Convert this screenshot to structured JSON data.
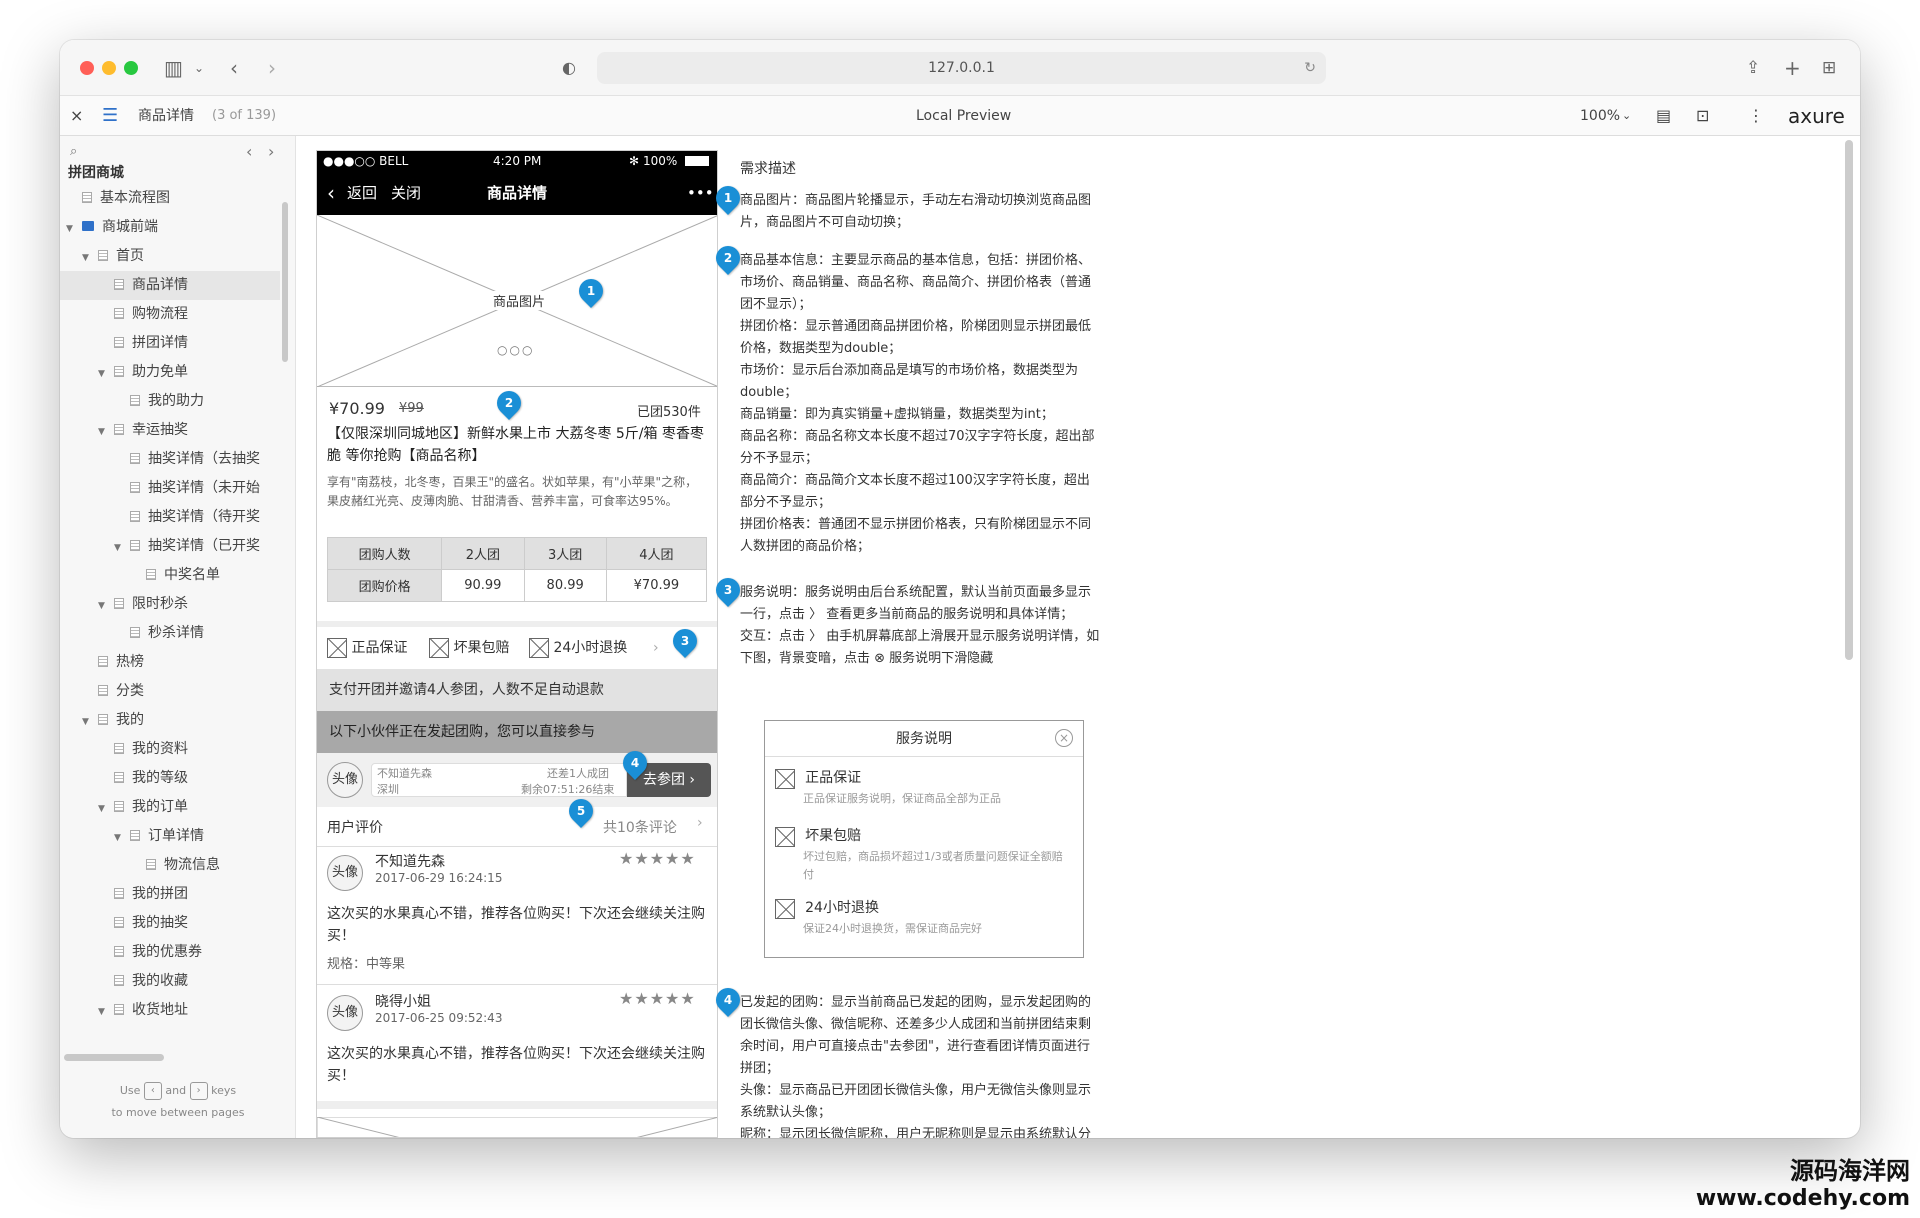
{
  "browser": {
    "url": "127.0.0.1",
    "traffic_colors": [
      "#ff5f57",
      "#febc2e",
      "#28c840"
    ]
  },
  "toolbar": {
    "close": "×",
    "page_title": "商品详情",
    "page_count": "(3 of 139)",
    "center": "Local Preview",
    "zoom": "100%",
    "brand": "axure"
  },
  "sidebar": {
    "project": "拼团商城",
    "items": [
      {
        "label": "基本流程图",
        "indent": 0,
        "arrow": "",
        "type": "page"
      },
      {
        "label": "商城前端",
        "indent": 0,
        "arrow": "▼",
        "type": "folder"
      },
      {
        "label": "首页",
        "indent": 1,
        "arrow": "▼",
        "type": "page"
      },
      {
        "label": "商品详情",
        "indent": 2,
        "arrow": "",
        "type": "page",
        "selected": true
      },
      {
        "label": "购物流程",
        "indent": 2,
        "arrow": "",
        "type": "page"
      },
      {
        "label": "拼团详情",
        "indent": 2,
        "arrow": "",
        "type": "page"
      },
      {
        "label": "助力免单",
        "indent": 2,
        "arrow": "▼",
        "type": "page"
      },
      {
        "label": "我的助力",
        "indent": 3,
        "arrow": "",
        "type": "page"
      },
      {
        "label": "幸运抽奖",
        "indent": 2,
        "arrow": "▼",
        "type": "page"
      },
      {
        "label": "抽奖详情（去抽奖",
        "indent": 3,
        "arrow": "",
        "type": "page"
      },
      {
        "label": "抽奖详情（未开始",
        "indent": 3,
        "arrow": "",
        "type": "page"
      },
      {
        "label": "抽奖详情（待开奖",
        "indent": 3,
        "arrow": "",
        "type": "page"
      },
      {
        "label": "抽奖详情（已开奖",
        "indent": 3,
        "arrow": "▼",
        "type": "page"
      },
      {
        "label": "中奖名单",
        "indent": 4,
        "arrow": "",
        "type": "page"
      },
      {
        "label": "限时秒杀",
        "indent": 2,
        "arrow": "▼",
        "type": "page"
      },
      {
        "label": "秒杀详情",
        "indent": 3,
        "arrow": "",
        "type": "page"
      },
      {
        "label": "热榜",
        "indent": 1,
        "arrow": "",
        "type": "page"
      },
      {
        "label": "分类",
        "indent": 1,
        "arrow": "",
        "type": "page"
      },
      {
        "label": "我的",
        "indent": 1,
        "arrow": "▼",
        "type": "page"
      },
      {
        "label": "我的资料",
        "indent": 2,
        "arrow": "",
        "type": "page"
      },
      {
        "label": "我的等级",
        "indent": 2,
        "arrow": "",
        "type": "page"
      },
      {
        "label": "我的订单",
        "indent": 2,
        "arrow": "▼",
        "type": "page"
      },
      {
        "label": "订单详情",
        "indent": 3,
        "arrow": "▼",
        "type": "page"
      },
      {
        "label": "物流信息",
        "indent": 4,
        "arrow": "",
        "type": "page"
      },
      {
        "label": "我的拼团",
        "indent": 2,
        "arrow": "",
        "type": "page"
      },
      {
        "label": "我的抽奖",
        "indent": 2,
        "arrow": "",
        "type": "page"
      },
      {
        "label": "我的优惠券",
        "indent": 2,
        "arrow": "",
        "type": "page"
      },
      {
        "label": "我的收藏",
        "indent": 2,
        "arrow": "",
        "type": "page"
      },
      {
        "label": "收货地址",
        "indent": 2,
        "arrow": "▼",
        "type": "page"
      }
    ],
    "hint_use": "Use",
    "hint_and": "and",
    "hint_keys": "keys",
    "hint_line2": "to move between pages"
  },
  "phone": {
    "carrier": "●●●○○ BELL",
    "time": "4:20 PM",
    "battery": "100%",
    "back": "返回",
    "close": "关闭",
    "nav_title": "商品详情",
    "more": "•••",
    "image_label": "商品图片",
    "dots": "○○○",
    "price": "¥70.99",
    "market_price": "¥99",
    "sold": "已团530件",
    "name": "【仅限深圳同城地区】新鲜水果上市 大荔冬枣 5斤/箱 枣香枣脆 等你抢购【商品名称】",
    "intro": "享有\"南荔枝，北冬枣，百果王\"的盛名。状如苹果，有\"小苹果\"之称，果皮赭红光亮、皮薄肉脆、甘甜清香、营养丰富，可食率达95%。",
    "table": [
      [
        "团购人数",
        "2人团",
        "3人团",
        "4人团"
      ],
      [
        "团购价格",
        "90.99",
        "80.99",
        "¥70.99"
      ]
    ],
    "services": [
      "正品保证",
      "坏果包赔",
      "24小时退换"
    ],
    "notice": "支付开团并邀请4人参团，人数不足自动退款",
    "group_header": "以下小伙伴正在发起团购，您可以直接参与",
    "group": {
      "avatar": "头像",
      "nick": "不知道先森",
      "city": "深圳",
      "need": "还差1人成团",
      "remain": "剩余07:51:26结束",
      "join": "去参团"
    },
    "reviews_title": "用户评价",
    "reviews_count": "共10条评论",
    "reviews": [
      {
        "avatar": "头像",
        "name": "不知道先森",
        "time": "2017-06-29 16:24:15",
        "stars": "★★★★★",
        "text": "这次买的水果真心不错，推荐各位购买！下次还会继续关注购买！",
        "spec": "规格：中等果"
      },
      {
        "avatar": "头像",
        "name": "晓得小姐",
        "time": "2017-06-25 09:52:43",
        "stars": "★★★★★",
        "text": "这次买的水果真心不错，推荐各位购买！下次还会继续关注购买！",
        "spec": ""
      }
    ]
  },
  "markers": [
    "1",
    "2",
    "3",
    "4",
    "5"
  ],
  "spec": {
    "title": "需求描述",
    "s1": "商品图片：商品图片轮播显示，手动左右滑动切换浏览商品图片，商品图片不可自动切换；",
    "s2": [
      "商品基本信息：主要显示商品的基本信息，包括：拼团价格、市场价、商品销量、商品名称、商品简介、拼团价格表（普通团不显示）；",
      "拼团价格：显示普通团商品拼团价格，阶梯团则显示拼团最低价格，数据类型为double；",
      "市场价：显示后台添加商品是填写的市场价格，数据类型为double；",
      "商品销量：即为真实销量+虚拟销量，数据类型为int；",
      "商品名称：商品名称文本长度不超过70汉字字符长度，超出部分不予显示；",
      "商品简介：商品简介文本长度不超过100汉字字符长度，超出部分不予显示；",
      "拼团价格表：普通团不显示拼团价格表，只有阶梯团显示不同人数拼团的商品价格；"
    ],
    "s3": [
      "服务说明：服务说明由后台系统配置，默认当前页面最多显示一行，点击 〉 查看更多当前商品的服务说明和具体详情；",
      "交互：点击 〉 由手机屏幕底部上滑展开显示服务说明详情，如下图，背景变暗，点击 ⊗ 服务说明下滑隐藏"
    ],
    "popup": {
      "title": "服务说明",
      "items": [
        {
          "name": "正品保证",
          "desc": "正品保证服务说明，保证商品全部为正品"
        },
        {
          "name": "坏果包赔",
          "desc": "坏过包赔，商品损坏超过1/3或者质量问题保证全额赔付"
        },
        {
          "name": "24小时退换",
          "desc": "保证24小时退换货，需保证商品完好"
        }
      ]
    },
    "s4": [
      "已发起的团购：显示当前商品已发起的团购，显示发起团购的团长微信头像、微信昵称、还差多少人成团和当前拼团结束剩余时间，用户可直接点击\"去参团\"，进行查看团详情页面进行拼团；",
      "头像：显示商品已开团团长微信头像，用户无微信头像则显示系统默认头像；",
      "昵称：显示团长微信昵称，用户无昵称则是显示由系统默认分配的用户编号；"
    ]
  },
  "watermark": {
    "line1": "源码海洋网",
    "line2": "www.codehy.com"
  },
  "colors": {
    "marker": "#1a8fd6",
    "folder": "#2f71c9"
  }
}
